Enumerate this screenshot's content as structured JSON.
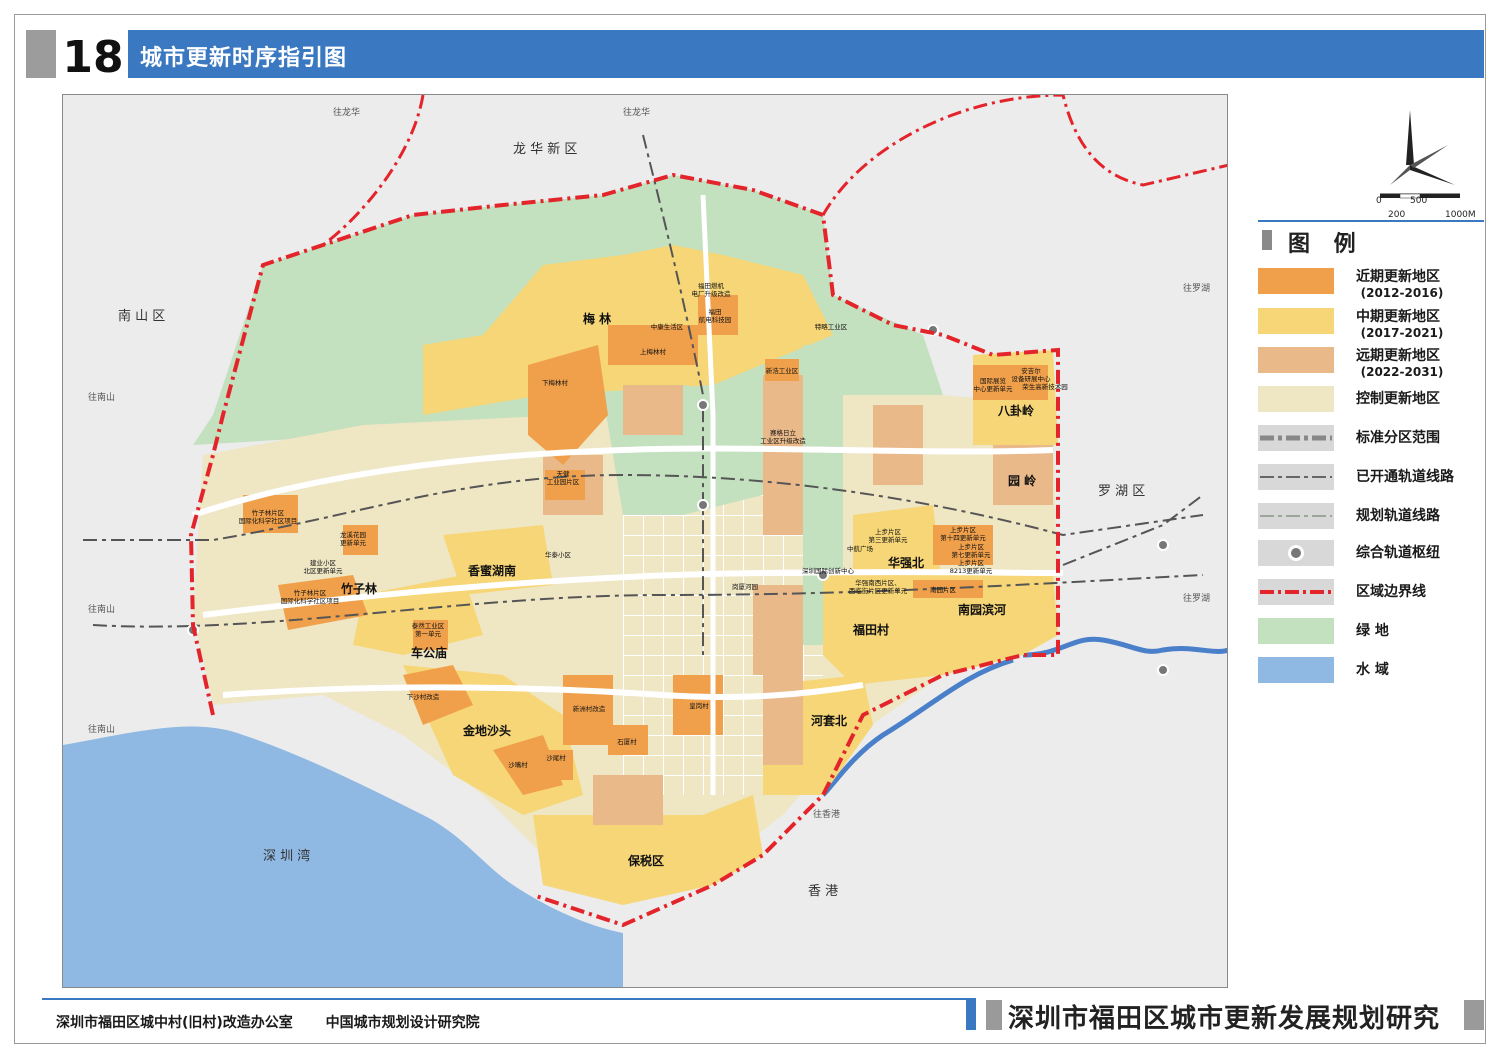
{
  "header": {
    "number": "18",
    "title": "城市更新时序指引图"
  },
  "legend": {
    "title": "图  例",
    "items": [
      {
        "key": "near",
        "label": "近期更新地区",
        "sub": "(2012-2016)",
        "color": "#f0a04b"
      },
      {
        "key": "mid",
        "label": "中期更新地区",
        "sub": "(2017-2021)",
        "color": "#f6d676"
      },
      {
        "key": "far",
        "label": "远期更新地区",
        "sub": "(2022-2031)",
        "color": "#e9b98a"
      },
      {
        "key": "control",
        "label": "控制更新地区",
        "sub": "",
        "color": "#efe6c4"
      },
      {
        "key": "std-boundary",
        "label": "标准分区范围",
        "sub": ""
      },
      {
        "key": "rail-open",
        "label": "已开通轨道线路",
        "sub": ""
      },
      {
        "key": "rail-plan",
        "label": "规划轨道线路",
        "sub": ""
      },
      {
        "key": "hub",
        "label": "综合轨道枢纽",
        "sub": ""
      },
      {
        "key": "border",
        "label": "区域边界线",
        "sub": "",
        "color": "#e3242b"
      },
      {
        "key": "green",
        "label": "绿  地",
        "sub": "",
        "color": "#c3e0bf"
      },
      {
        "key": "water",
        "label": "水  域",
        "sub": "",
        "color": "#8fb8e2"
      }
    ]
  },
  "scale": {
    "marks": [
      "0",
      "500",
      "200",
      "1000M"
    ]
  },
  "footer": {
    "org1": "深圳市福田区城中村(旧村)改造办公室",
    "org2": "中国城市规划设计研究院",
    "project": "深圳市福田区城市更新发展规划研究"
  },
  "map": {
    "districts": [
      {
        "key": "longhua",
        "text": "龙 华 新 区"
      },
      {
        "key": "nanshan",
        "text": "南 山 区"
      },
      {
        "key": "luohu",
        "text": "罗 湖 区"
      },
      {
        "key": "shenzhenwan",
        "text": "深 圳 湾"
      },
      {
        "key": "hongkong",
        "text": "香 港"
      }
    ],
    "directions": [
      {
        "key": "to-longhua-1",
        "text": "往龙华"
      },
      {
        "key": "to-longhua-2",
        "text": "往龙华"
      },
      {
        "key": "to-nanshan-1",
        "text": "往南山"
      },
      {
        "key": "to-nanshan-2",
        "text": "往南山"
      },
      {
        "key": "to-nanshan-3",
        "text": "往南山"
      },
      {
        "key": "to-luohu-1",
        "text": "往罗湖"
      },
      {
        "key": "to-luohu-2",
        "text": "往罗湖"
      },
      {
        "key": "to-hk",
        "text": "往香港"
      }
    ],
    "areas": [
      {
        "key": "meilin",
        "text": "梅 林"
      },
      {
        "key": "zhuzilin",
        "text": "竹子林"
      },
      {
        "key": "xiangmihu",
        "text": "香蜜湖南"
      },
      {
        "key": "chegongmiao",
        "text": "车公庙"
      },
      {
        "key": "jindishatou",
        "text": "金地沙头"
      },
      {
        "key": "baoshuiqu",
        "text": "保税区"
      },
      {
        "key": "futiancun",
        "text": "福田村"
      },
      {
        "key": "huaqiangbei",
        "text": "华强北"
      },
      {
        "key": "nanyuanbinhe",
        "text": "南园滨河"
      },
      {
        "key": "bagualing",
        "text": "八卦岭"
      },
      {
        "key": "yuanling",
        "text": "园 岭"
      },
      {
        "key": "hetaobei",
        "text": "河套北"
      }
    ],
    "sites": [
      {
        "key": "s1",
        "lines": [
          "福田燃机",
          "电厂升级改造"
        ]
      },
      {
        "key": "s2",
        "lines": [
          "福田",
          "航电科技园"
        ]
      },
      {
        "key": "s3",
        "lines": [
          "中康生活区"
        ]
      },
      {
        "key": "s4",
        "lines": [
          "特略工业区"
        ]
      },
      {
        "key": "s5",
        "lines": [
          "上梅林村"
        ]
      },
      {
        "key": "s6",
        "lines": [
          "下梅林村"
        ]
      },
      {
        "key": "s7",
        "lines": [
          "新浩工业区"
        ]
      },
      {
        "key": "s8",
        "lines": [
          "赛格日立",
          "工业区升级改造"
        ]
      },
      {
        "key": "s9",
        "lines": [
          "天健",
          "工业园片区"
        ]
      },
      {
        "key": "s10",
        "lines": [
          "国际展览",
          "中心更新单元"
        ]
      },
      {
        "key": "s11",
        "lines": [
          "安吉尔",
          "设备研展中心"
        ]
      },
      {
        "key": "s12",
        "lines": [
          "荣生高新技术园"
        ]
      },
      {
        "key": "s13",
        "lines": [
          "竹子林片区",
          "国际化科学社区项目"
        ]
      },
      {
        "key": "s14",
        "lines": [
          "龙溪花园",
          "更新单元"
        ]
      },
      {
        "key": "s15",
        "lines": [
          "华泰小区"
        ]
      },
      {
        "key": "s16",
        "lines": [
          "建业小区",
          "北区更新单元"
        ]
      },
      {
        "key": "s17",
        "lines": [
          "竹子林片区",
          "国际化科学社区项目"
        ]
      },
      {
        "key": "s18",
        "lines": [
          "泰然工业区",
          "第一单元"
        ]
      },
      {
        "key": "s19",
        "lines": [
          "上步片区",
          "第三更新单元"
        ]
      },
      {
        "key": "s20",
        "lines": [
          "上步片区",
          "第十四更新单元"
        ]
      },
      {
        "key": "s21",
        "lines": [
          "上步片区",
          "第七更新单元"
        ]
      },
      {
        "key": "s22",
        "lines": [
          "上步片区",
          "8213更新单元"
        ]
      },
      {
        "key": "s23",
        "lines": [
          "中航广场"
        ]
      },
      {
        "key": "s24",
        "lines": [
          "深圳国际创新中心"
        ]
      },
      {
        "key": "s25",
        "lines": [
          "岗厦河园"
        ]
      },
      {
        "key": "s26",
        "lines": [
          "华强南西片区、",
          "西临街片区更新单元"
        ]
      },
      {
        "key": "s27",
        "lines": [
          "南园片区"
        ]
      },
      {
        "key": "s28",
        "lines": [
          "下沙村改造"
        ]
      },
      {
        "key": "s29",
        "lines": [
          "新洲村改造"
        ]
      },
      {
        "key": "s30",
        "lines": [
          "皇岗村"
        ]
      },
      {
        "key": "s31",
        "lines": [
          "石厦村"
        ]
      },
      {
        "key": "s32",
        "lines": [
          "沙尾村"
        ]
      },
      {
        "key": "s33",
        "lines": [
          "沙嘴村"
        ]
      }
    ]
  }
}
